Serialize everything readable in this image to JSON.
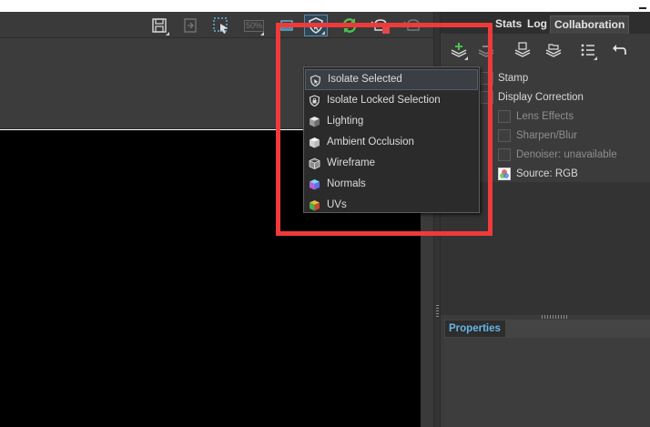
{
  "toolbar": {
    "buttons": [
      {
        "name": "save-icon"
      },
      {
        "name": "export-icon"
      },
      {
        "name": "region-select-icon"
      },
      {
        "name": "zoom-50-icon",
        "label": "50%"
      },
      {
        "name": "frame-icon"
      },
      {
        "name": "isolate-shield-icon"
      },
      {
        "name": "refresh-icon"
      },
      {
        "name": "teapot-stop-icon"
      },
      {
        "name": "teapot-icon"
      }
    ]
  },
  "tabs": [
    "Stats",
    "Log",
    "Collaboration"
  ],
  "layers": [
    {
      "label": "Stamp",
      "dim": false
    },
    {
      "label": "Display Correction",
      "dim": false
    },
    {
      "label": "Lens Effects",
      "dim": true
    },
    {
      "label": "Sharpen/Blur",
      "dim": true
    },
    {
      "label": "Denoiser: unavailable",
      "dim": true
    },
    {
      "label": "Source: RGB",
      "dim": false
    }
  ],
  "properties_tab": "Properties",
  "menu": {
    "items": [
      {
        "label": "Isolate Selected",
        "icon": "isolate-selected-icon",
        "selected": true
      },
      {
        "label": "Isolate Locked Selection",
        "icon": "lock-shield-icon",
        "selected": false
      },
      {
        "label": "Lighting",
        "icon": "lighting-cube-icon",
        "selected": false
      },
      {
        "label": "Ambient Occlusion",
        "icon": "ambient-occlusion-cube-icon",
        "selected": false
      },
      {
        "label": "Wireframe",
        "icon": "wireframe-cube-icon",
        "selected": false
      },
      {
        "label": "Normals",
        "icon": "normals-cube-icon",
        "selected": false
      },
      {
        "label": "UVs",
        "icon": "uvs-cube-icon",
        "selected": false
      }
    ]
  },
  "colors": {
    "highlight": "#f03a3a",
    "tab_accent": "#66b6e6",
    "refresh_green": "#4ec24e"
  }
}
